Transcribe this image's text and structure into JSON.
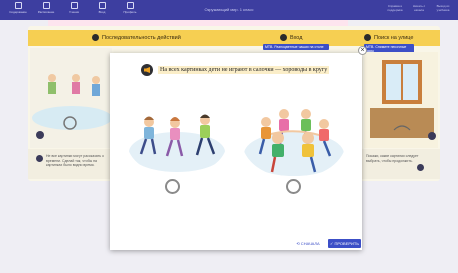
{
  "topbar": {
    "items": [
      "Содержание",
      "Расписание",
      "Ученик",
      "Вход",
      "Профиль"
    ],
    "title": "Окружающий мир. 1 класс",
    "right": [
      "Справка и поддержка",
      "Начать с начала",
      "Выход из учебника"
    ]
  },
  "background_lesson": {
    "panel_left_title": "Последовательность действий",
    "panel_mid_title": "Вход",
    "panel_right_title": "Поиск на улице",
    "ribbon_mid": "МТВ. Разноцветные чашки на столе",
    "ribbon_right": "МТВ. Снимите песочные часы",
    "side_left": "Не все картинки могут рассказать о времени. Сделай так, чтобы на картинках было видно время.",
    "side_right": "Покажи, какие картинки следует выбрать, чтобы продолжить."
  },
  "modal": {
    "question": "На всех картинках дети не играют в салочки — хороводы в кругу",
    "btn_again": "⟲ СНАЧАЛА",
    "btn_check": "✓ ПРОВЕРИТЬ",
    "close": "×"
  },
  "options": [
    {
      "label": "children-walking-line",
      "selected": false
    },
    {
      "label": "children-circle-dance",
      "selected": false
    }
  ]
}
